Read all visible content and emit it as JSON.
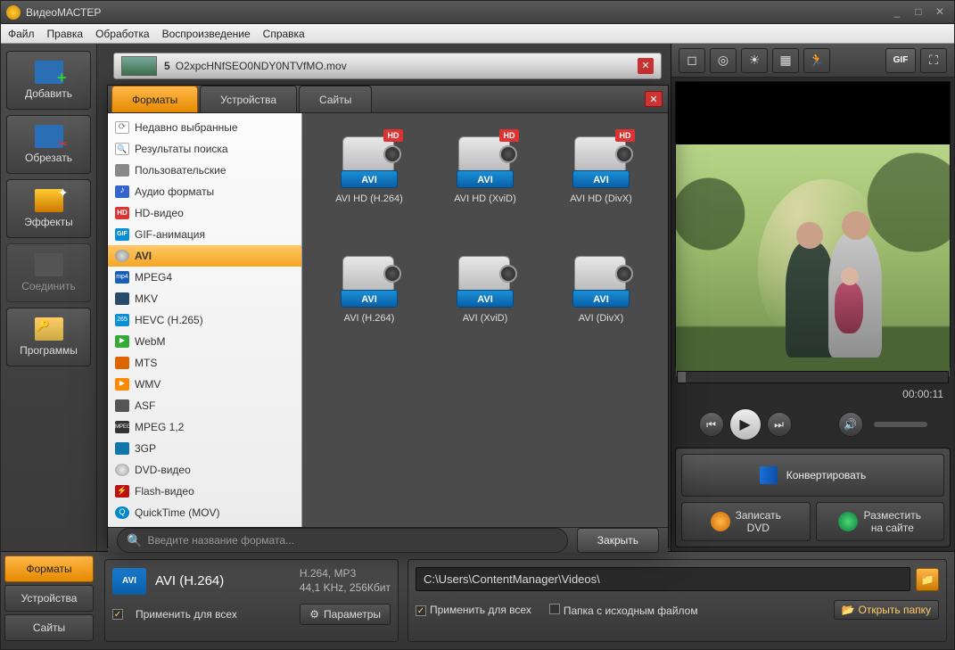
{
  "app": {
    "title": "ВидеоМАСТЕР"
  },
  "winbtns": {
    "min": "_",
    "max": "□",
    "close": "✕"
  },
  "menu": [
    "Файл",
    "Правка",
    "Обработка",
    "Воспроизведение",
    "Справка"
  ],
  "sidebar": [
    {
      "label": "Добавить",
      "icon": "add"
    },
    {
      "label": "Обрезать",
      "icon": "cut"
    },
    {
      "label": "Эффекты",
      "icon": "fx"
    },
    {
      "label": "Соединить",
      "icon": "join",
      "disabled": true
    },
    {
      "label": "Программы",
      "icon": "prog"
    }
  ],
  "file": {
    "index": "5",
    "name": "O2xpcHNfSEO0NDY0NTVfMO.mov"
  },
  "preview": {
    "time": "00:00:11"
  },
  "preview_tools": [
    "crop-icon",
    "rotate-icon",
    "brightness-icon",
    "enhance-icon",
    "speed-icon"
  ],
  "preview_tools_right": [
    {
      "t": "GIF"
    },
    {
      "t": "⛶"
    }
  ],
  "controls": {
    "prev": "⏮",
    "play": "▶",
    "next": "⏭",
    "vol": "🔊"
  },
  "convert": {
    "label": "Конвертировать"
  },
  "sub": [
    {
      "l1": "Записать",
      "l2": "DVD",
      "orb": "dvd"
    },
    {
      "l1": "Разместить",
      "l2": "на сайте",
      "orb": "web"
    }
  ],
  "bottom_tabs": [
    {
      "label": "Форматы",
      "active": true
    },
    {
      "label": "Устройства"
    },
    {
      "label": "Сайты"
    }
  ],
  "fmt": {
    "badge": "AVI",
    "name": "AVI (H.264)",
    "det1": "H.264, MP3",
    "det2": "44,1 KHz, 256Кбит",
    "apply": "Применить для всех",
    "params": "Параметры"
  },
  "path": {
    "value": "C:\\Users\\ContentManager\\Videos\\",
    "apply": "Применить для всех",
    "source": "Папка с исходным файлом",
    "open": "Открыть папку"
  },
  "popup": {
    "tabs": [
      {
        "label": "Форматы",
        "active": true
      },
      {
        "label": "Устройства"
      },
      {
        "label": "Сайты"
      }
    ],
    "cats": [
      {
        "label": "Недавно выбранные",
        "ic": "recent"
      },
      {
        "label": "Результаты поиска",
        "ic": "search"
      },
      {
        "label": "Пользовательские",
        "ic": "user"
      },
      {
        "label": "Аудио форматы",
        "ic": "audio"
      },
      {
        "label": "HD-видео",
        "ic": "hd",
        "t": "HD"
      },
      {
        "label": "GIF-анимация",
        "ic": "gif",
        "t": "GIF"
      },
      {
        "label": "AVI",
        "ic": "avi",
        "selected": true
      },
      {
        "label": "MPEG4",
        "ic": "mp4",
        "t": "mp4"
      },
      {
        "label": "MKV",
        "ic": "mkv"
      },
      {
        "label": "HEVC (H.265)",
        "ic": "hevc",
        "t": "265"
      },
      {
        "label": "WebM",
        "ic": "webm"
      },
      {
        "label": "MTS",
        "ic": "mts"
      },
      {
        "label": "WMV",
        "ic": "wmv"
      },
      {
        "label": "ASF",
        "ic": "asf"
      },
      {
        "label": "MPEG 1,2",
        "ic": "mpeg",
        "t": "MPEG"
      },
      {
        "label": "3GP",
        "ic": "tgp"
      },
      {
        "label": "DVD-видео",
        "ic": "dvd"
      },
      {
        "label": "Flash-видео",
        "ic": "flash"
      },
      {
        "label": "QuickTime (MOV)",
        "ic": "qt"
      }
    ],
    "presets": [
      {
        "badge": "AVI",
        "hd": true,
        "label": "AVI HD (H.264)"
      },
      {
        "badge": "AVI",
        "hd": true,
        "label": "AVI HD (XviD)"
      },
      {
        "badge": "AVI",
        "hd": true,
        "label": "AVI HD (DivX)"
      },
      {
        "badge": "AVI",
        "hd": false,
        "label": "AVI (H.264)"
      },
      {
        "badge": "AVI",
        "hd": false,
        "label": "AVI (XviD)"
      },
      {
        "badge": "AVI",
        "hd": false,
        "label": "AVI (DivX)"
      }
    ],
    "search_placeholder": "Введите название формата...",
    "close": "Закрыть"
  }
}
